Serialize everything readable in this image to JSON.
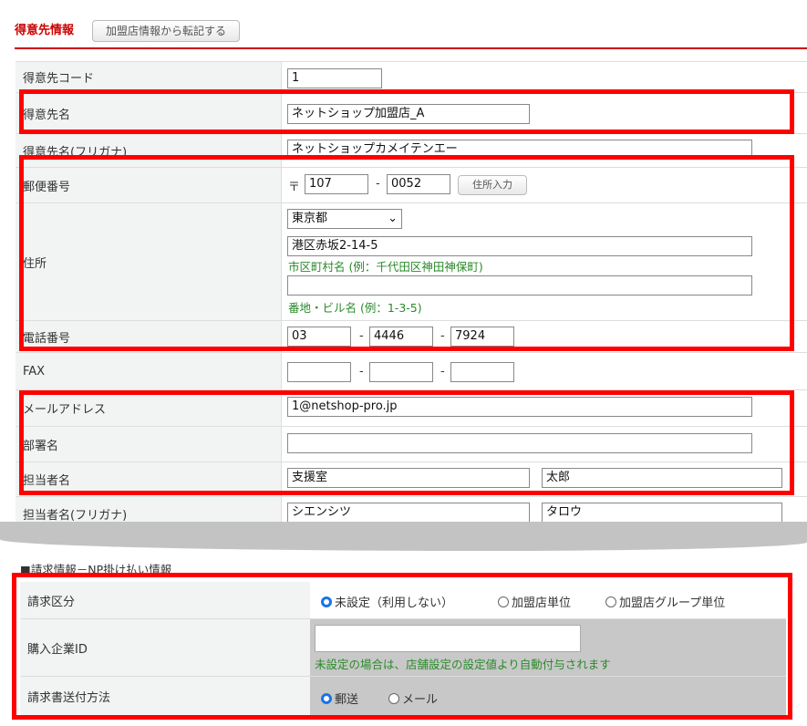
{
  "header": {
    "title": "得意先情報",
    "copy_button": "加盟店情報から転記する"
  },
  "customer": {
    "code": {
      "label": "得意先コード",
      "value": "1"
    },
    "name": {
      "label": "得意先名",
      "value": "ネットショップ加盟店_A"
    },
    "name_kana": {
      "label": "得意先名(フリガナ)",
      "value": "ネットショップカメイテンエー"
    },
    "postal": {
      "label": "郵便番号",
      "prefix": "〒",
      "part1": "107",
      "part2": "0052",
      "button": "住所入力"
    },
    "address": {
      "label": "住所",
      "prefecture": "東京都",
      "city": "港区赤坂2-14-5",
      "city_hint": "市区町村名 (例：千代田区神田神保町)",
      "street": "",
      "street_hint": "番地・ビル名 (例：1-3-5)"
    },
    "phone": {
      "label": "電話番号",
      "part1": "03",
      "part2": "4446",
      "part3": "7924"
    },
    "fax": {
      "label": "FAX",
      "part1": "",
      "part2": "",
      "part3": ""
    },
    "email": {
      "label": "メールアドレス",
      "value": "1@netshop-pro.jp"
    },
    "department": {
      "label": "部署名",
      "value": ""
    },
    "contact": {
      "label": "担当者名",
      "last": "支援室",
      "first": "太郎"
    },
    "contact_kana": {
      "label": "担当者名(フリガナ)",
      "last": "シエンシツ",
      "first": "タロウ"
    },
    "separator": "-"
  },
  "billing": {
    "section_title": "■請求情報－NP掛け払い情報",
    "type": {
      "label": "請求区分",
      "options": [
        "未設定（利用しない）",
        "加盟店単位",
        "加盟店グループ単位"
      ],
      "selected": 0
    },
    "company_id": {
      "label": "購入企業ID",
      "value": "",
      "hint": "未設定の場合は、店舗設定の設定値より自動付与されます"
    },
    "delivery": {
      "label": "請求書送付方法",
      "options": [
        "郵送",
        "メール"
      ],
      "selected": 0
    }
  },
  "colors": {
    "highlight": "#ff0000",
    "title": "#cc0000",
    "hint": "#2a8a2a",
    "radio": "#1a73e8"
  }
}
